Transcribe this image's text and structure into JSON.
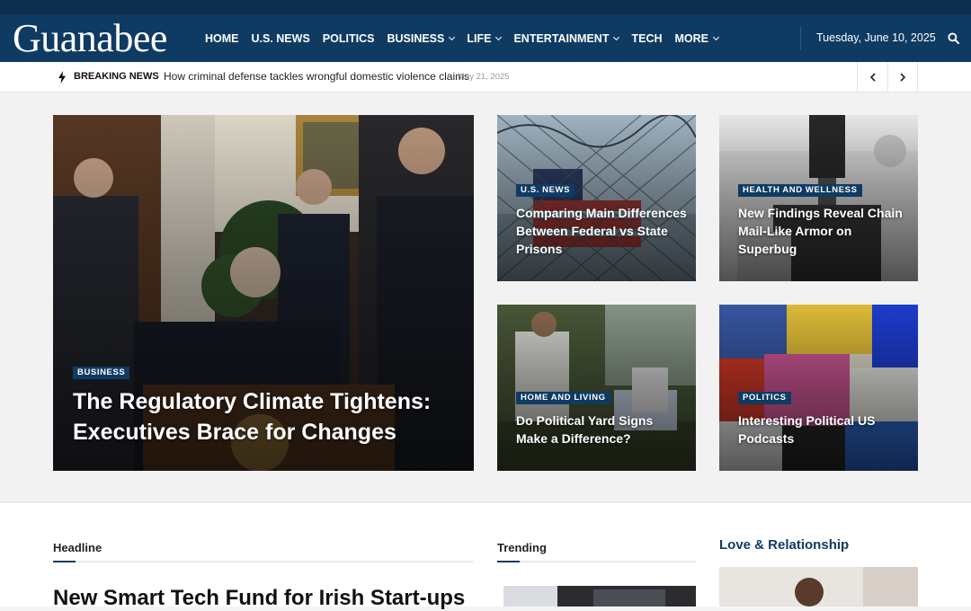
{
  "site": {
    "logo": "Guanabee",
    "nav": [
      {
        "label": "HOME",
        "dropdown": false
      },
      {
        "label": "U.S. NEWS",
        "dropdown": false
      },
      {
        "label": "POLITICS",
        "dropdown": false
      },
      {
        "label": "BUSINESS",
        "dropdown": true
      },
      {
        "label": "LIFE",
        "dropdown": true
      },
      {
        "label": "ENTERTAINMENT",
        "dropdown": true
      },
      {
        "label": "TECH",
        "dropdown": false
      },
      {
        "label": "MORE",
        "dropdown": true
      }
    ],
    "date": "Tuesday, June 10, 2025"
  },
  "breaking": {
    "label": "BREAKING NEWS",
    "headline": "How criminal defense tackles wrongful domestic violence claims",
    "date": "May 21, 2025"
  },
  "featured": [
    {
      "category": "BUSINESS",
      "title": "The Regulatory Climate Tightens: Executives Brace for Changes"
    },
    {
      "category": "U.S. NEWS",
      "title": "Comparing Main Differences Between Federal vs State Prisons"
    },
    {
      "category": "HEALTH AND WELLNESS",
      "title": "New Findings Reveal Chain Mail-Like Armor on Superbug"
    },
    {
      "category": "HOME AND LIVING",
      "title": "Do Political Yard Signs Make a Difference?"
    },
    {
      "category": "POLITICS",
      "title": "Interesting Political US Podcasts"
    }
  ],
  "sections": {
    "headline": "Headline",
    "trending": "Trending",
    "love": "Love & Relationship",
    "headline_story": "New Smart Tech Fund for Irish Start-ups"
  },
  "colors": {
    "brand": "#0f3b63",
    "topstrip": "#0e2e4d"
  }
}
